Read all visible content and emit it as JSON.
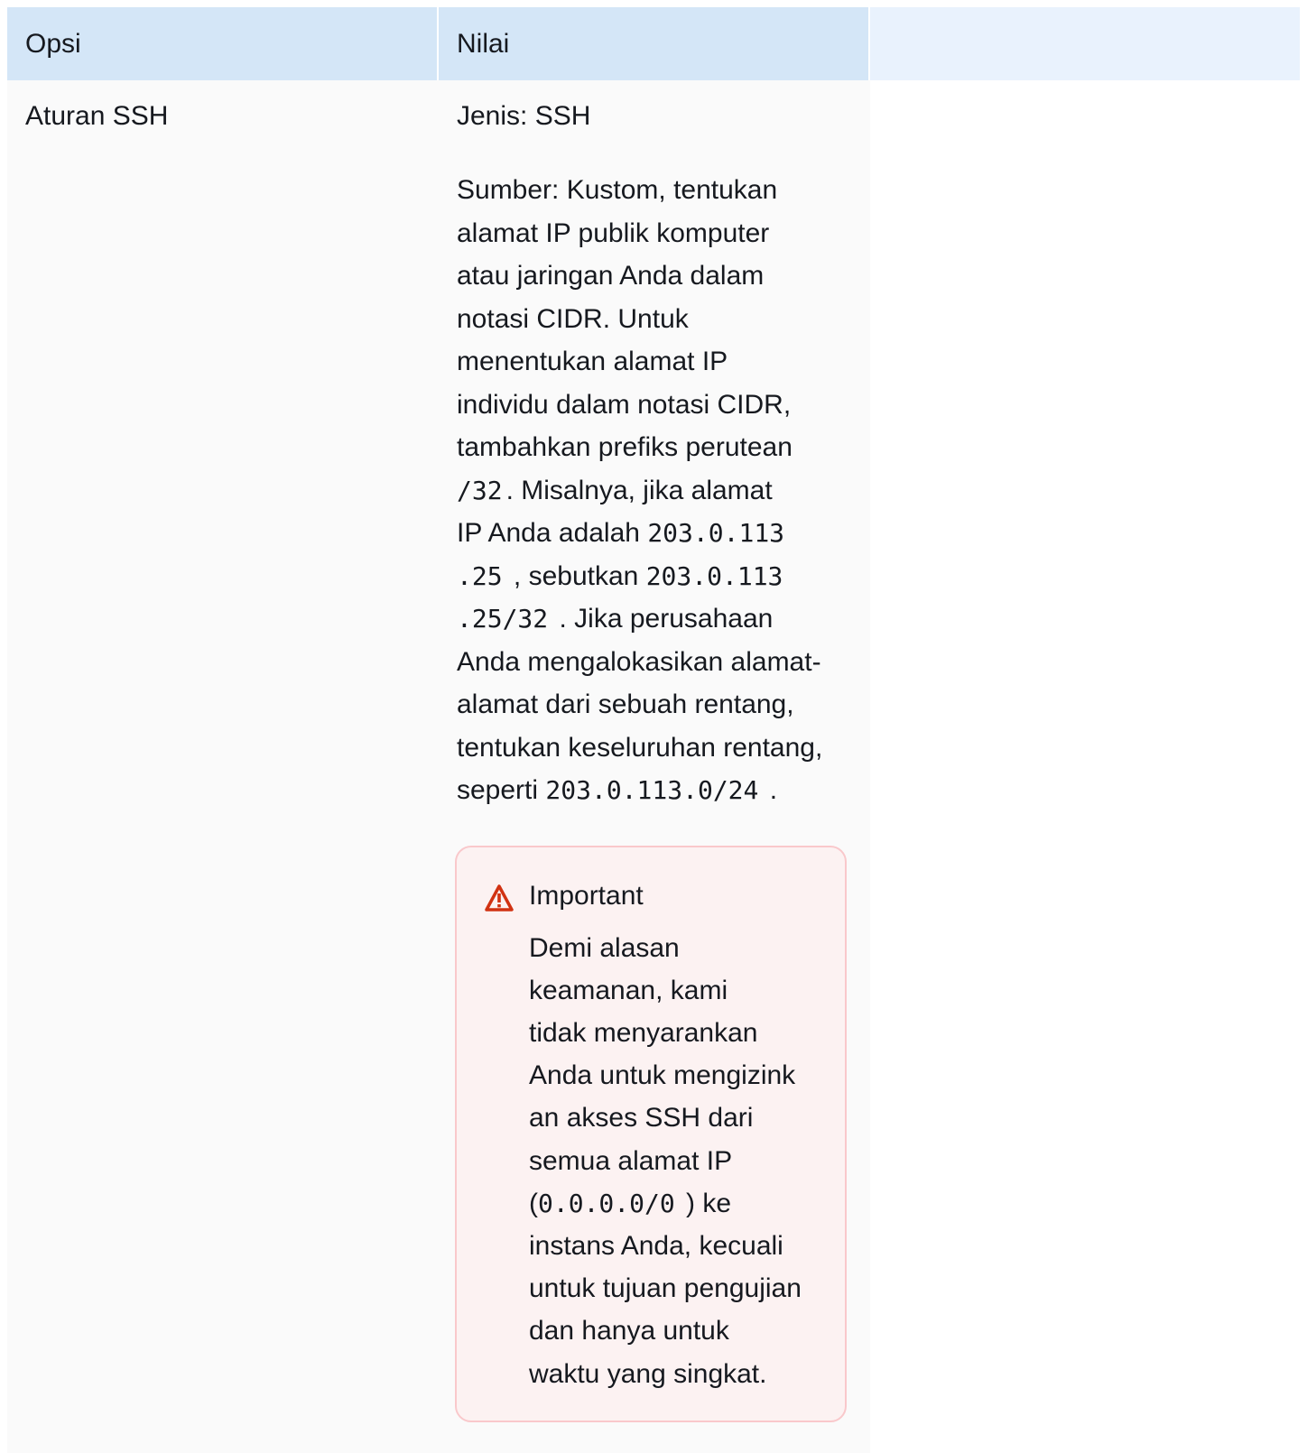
{
  "table": {
    "headers": [
      "Opsi",
      "Nilai",
      ""
    ],
    "row": {
      "option": "Aturan SSH",
      "type_text": "Jenis: SSH",
      "source": {
        "lines": [
          [
            {
              "t": "Sumber: Kustom, tentukan"
            }
          ],
          [
            {
              "t": "alamat IP publik komputer"
            }
          ],
          [
            {
              "t": "atau jaringan Anda dalam"
            }
          ],
          [
            {
              "t": "notasi CIDR. Untuk"
            }
          ],
          [
            {
              "t": "menentukan alamat IP"
            }
          ],
          [
            {
              "t": "individu dalam notasi CIDR,"
            }
          ],
          [
            {
              "t": "tambahkan prefiks perutean"
            }
          ],
          [
            {
              "t": "/32",
              "code": true
            },
            {
              "t": ". Misalnya, jika alamat"
            }
          ],
          [
            {
              "t": "IP Anda adalah "
            },
            {
              "t": "203.0.113",
              "code": true
            }
          ],
          [
            {
              "t": ".25",
              "code": true
            },
            {
              "t": " , sebutkan "
            },
            {
              "t": "203.0.113",
              "code": true
            }
          ],
          [
            {
              "t": ".25/32",
              "code": true
            },
            {
              "t": " . Jika perusahaan"
            }
          ],
          [
            {
              "t": "Anda mengalokasikan alamat-"
            }
          ],
          [
            {
              "t": "alamat dari sebuah rentang,"
            }
          ],
          [
            {
              "t": "tentukan keseluruhan rentang,"
            }
          ],
          [
            {
              "t": "seperti "
            },
            {
              "t": "203.0.113.0/24",
              "code": true
            },
            {
              "t": " ."
            }
          ]
        ]
      },
      "alert": {
        "icon": "warning-triangle-icon",
        "color": "#d13212",
        "title": "Important",
        "lines": [
          [
            {
              "t": "Demi alasan"
            }
          ],
          [
            {
              "t": "keamanan, kami"
            }
          ],
          [
            {
              "t": "tidak menyarankan"
            }
          ],
          [
            {
              "t": "Anda untuk mengizink"
            }
          ],
          [
            {
              "t": "an akses SSH dari"
            }
          ],
          [
            {
              "t": "semua alamat IP"
            }
          ],
          [
            {
              "t": "("
            },
            {
              "t": "0.0.0.0/0",
              "code": true
            },
            {
              "t": " ) ke"
            }
          ],
          [
            {
              "t": "instans Anda, kecuali"
            }
          ],
          [
            {
              "t": "untuk tujuan pengujian"
            }
          ],
          [
            {
              "t": "dan hanya untuk"
            }
          ],
          [
            {
              "t": "waktu yang singkat."
            }
          ]
        ]
      }
    }
  }
}
